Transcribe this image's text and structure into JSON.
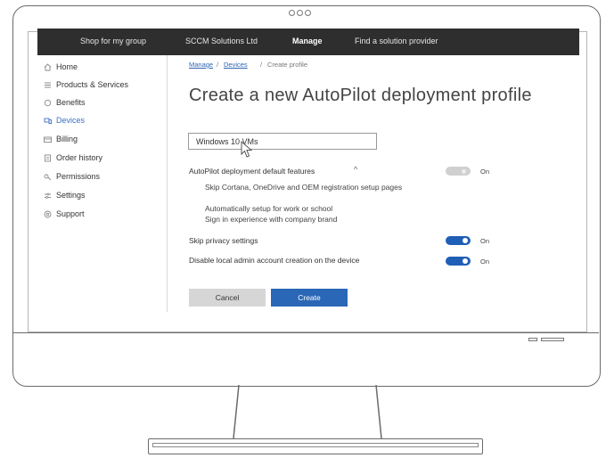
{
  "topnav": {
    "items": [
      {
        "label": "Shop for my group",
        "active": false
      },
      {
        "label": "SCCM Solutions Ltd",
        "active": false
      },
      {
        "label": "Manage",
        "active": true
      },
      {
        "label": "Find a solution provider",
        "active": false
      }
    ]
  },
  "sidebar": {
    "items": [
      {
        "label": "Home",
        "icon": "home-icon",
        "active": false
      },
      {
        "label": "Products & Services",
        "icon": "list-icon",
        "active": false
      },
      {
        "label": "Benefits",
        "icon": "benefits-icon",
        "active": false
      },
      {
        "label": "Devices",
        "icon": "devices-icon",
        "active": true
      },
      {
        "label": "Billing",
        "icon": "billing-icon",
        "active": false
      },
      {
        "label": "Order history",
        "icon": "order-history-icon",
        "active": false
      },
      {
        "label": "Permissions",
        "icon": "permissions-icon",
        "active": false
      },
      {
        "label": "Settings",
        "icon": "settings-icon",
        "active": false
      },
      {
        "label": "Support",
        "icon": "support-icon",
        "active": false
      }
    ]
  },
  "breadcrumb": {
    "items": [
      "Manage",
      "Devices",
      "Create profile"
    ],
    "separator": "/"
  },
  "page": {
    "title": "Create a new AutoPilot deployment profile"
  },
  "form": {
    "profile_name": "Windows 10 VMs",
    "features_label": "AutoPilot deployment default features",
    "features_chevron": "^",
    "features_toggle_text": "On",
    "features": [
      "Skip Cortana, OneDrive and OEM registration setup pages",
      "Automatically setup for work or school",
      "Sign in experience with company brand"
    ],
    "skip_privacy_label": "Skip privacy settings",
    "skip_privacy_state": "On",
    "disable_admin_label": "Disable local admin account creation on the device",
    "disable_admin_state": "On"
  },
  "buttons": {
    "cancel": "Cancel",
    "create": "Create"
  },
  "colors": {
    "accent": "#2a67b7",
    "topnav_bg": "#2e2e2e",
    "toggle_disabled": "#d0d0d0"
  }
}
